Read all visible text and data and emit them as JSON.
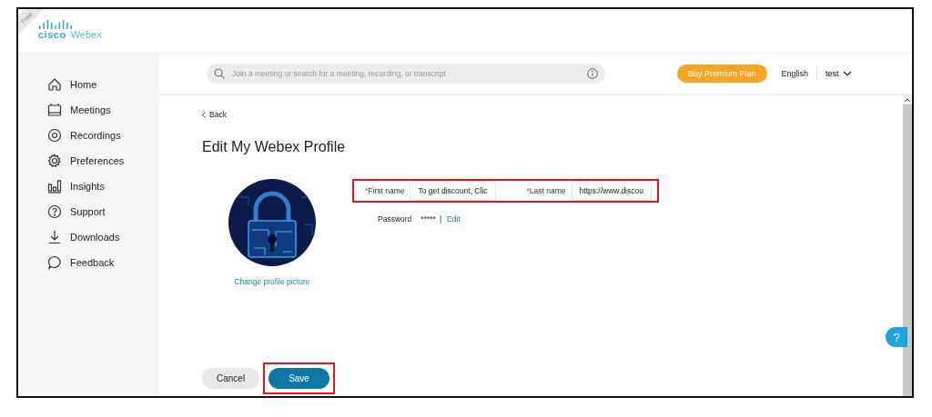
{
  "brand": {
    "ribbon": "Free",
    "company": "cisco",
    "product": "Webex"
  },
  "sidebar": {
    "items": [
      {
        "label": "Home",
        "kind": "home",
        "selected": false
      },
      {
        "label": "Meetings",
        "kind": "calendar",
        "selected": false
      },
      {
        "label": "Recordings",
        "kind": "record",
        "selected": false
      },
      {
        "label": "Preferences",
        "kind": "gear",
        "selected": false
      },
      {
        "label": "Insights",
        "kind": "bars",
        "selected": false
      },
      {
        "label": "Support",
        "kind": "help",
        "selected": false
      },
      {
        "label": "Downloads",
        "kind": "download",
        "selected": false
      },
      {
        "label": "Feedback",
        "kind": "chat",
        "selected": false
      }
    ]
  },
  "top_bar": {
    "search": {
      "placeholder": "Join a meeting or search for a meeting, recording, or transcript"
    },
    "premium_button": "Buy Premium Plan",
    "language": "English",
    "user": "test"
  },
  "page": {
    "back": "Back",
    "title": "Edit My Webex Profile",
    "change_picture": "Change profile picture",
    "fields": [
      {
        "required_mark": "*",
        "label": "First name",
        "value": "To get discount, Clic"
      },
      {
        "required_mark": "*",
        "label": "Last name",
        "value": "https://www.discou"
      }
    ],
    "password": {
      "label": "Password",
      "value": "*****",
      "separator": "|",
      "edit": "Edit"
    },
    "buttons": [
      {
        "label": "Cancel",
        "kind": "secondary"
      },
      {
        "label": "Save",
        "kind": "primary"
      }
    ],
    "help_button": "?"
  }
}
